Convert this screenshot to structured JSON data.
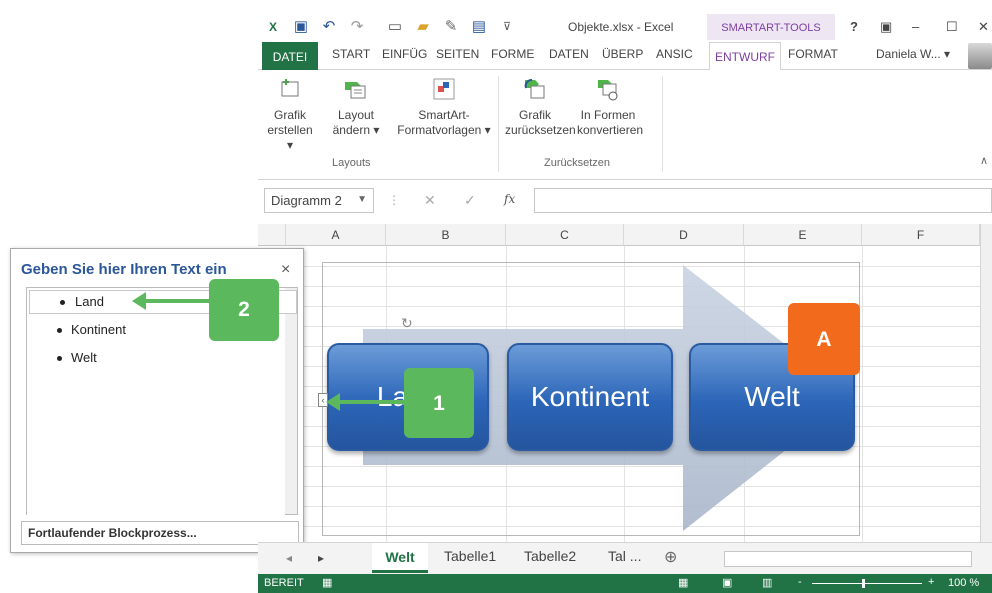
{
  "window": {
    "title": "Objekte.xlsx - Excel",
    "contextual_tab_group": "SMARTART-TOOLS",
    "help": "?",
    "minimize": "–",
    "maximize": "☐",
    "close": "✕"
  },
  "tabs": {
    "file": "DATEI",
    "items": [
      "START",
      "EINFÜG",
      "SEITEN",
      "FORME",
      "DATEN",
      "ÜBERP",
      "ANSIC"
    ],
    "active": "ENTWURF",
    "format": "FORMAT",
    "user": "Daniela W... ▾"
  },
  "ribbon": {
    "grafik_erstellen": "Grafik erstellen ▾",
    "layout_aendern": "Layout ändern ▾",
    "smartart_formatvorlagen": "SmartArt-Formatvorlagen ▾",
    "grafik_zuruecksetzen": "Grafik zurücksetzen",
    "in_formen_konvertieren": "In Formen konvertieren",
    "group_layouts": "Layouts",
    "group_zuruecksetzen": "Zurücksetzen"
  },
  "formula_bar": {
    "name_box": "Diagramm 2",
    "fx": "fx"
  },
  "columns": [
    "A",
    "B",
    "C",
    "D",
    "E",
    "F"
  ],
  "smartart": {
    "shapes": [
      "Land",
      "Kontinent",
      "Welt"
    ]
  },
  "text_pane": {
    "title": "Geben Sie hier Ihren Text ein",
    "close": "×",
    "items": [
      "Land",
      "Kontinent",
      "Welt"
    ],
    "footer": "Fortlaufender Blockprozess..."
  },
  "callouts": {
    "one": "1",
    "two": "2",
    "a": "A"
  },
  "colors": {
    "callout_green": "#5cb85c",
    "callout_orange": "#f26a1b",
    "excel_green": "#217346",
    "smartart_blue": "#2c65b8",
    "arrow_green": "#4fb54a"
  },
  "sheets": {
    "active": "Welt",
    "others": [
      "Tabelle1",
      "Tabelle2",
      "Tal ..."
    ],
    "add": "⊕"
  },
  "status": {
    "ready": "BEREIT",
    "zoom": "100 %",
    "minus": "-",
    "plus": "+"
  }
}
